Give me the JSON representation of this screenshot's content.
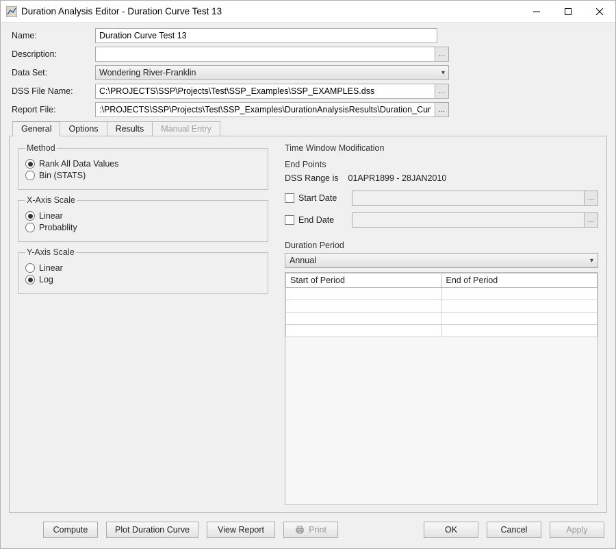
{
  "window": {
    "title": "Duration Analysis Editor - Duration Curve Test 13"
  },
  "fields": {
    "name_label": "Name:",
    "name_value": "Duration Curve Test 13",
    "desc_label": "Description:",
    "desc_value": "",
    "data_set_label": "Data Set:",
    "data_set_value": "Wondering River-Franklin",
    "dss_file_label": "DSS File Name:",
    "dss_file_value": "C:\\PROJECTS\\SSP\\Projects\\Test\\SSP_Examples\\SSP_EXAMPLES.dss",
    "report_file_label": "Report File:",
    "report_file_value": ":\\PROJECTS\\SSP\\Projects\\Test\\SSP_Examples\\DurationAnalysisResults\\Duration_Curve_T..."
  },
  "tabs": {
    "general": "General",
    "options": "Options",
    "results": "Results",
    "manual": "Manual Entry"
  },
  "method": {
    "legend": "Method",
    "rank": "Rank All Data Values",
    "bin": "Bin (STATS)"
  },
  "x_axis": {
    "legend": "X-Axis Scale",
    "linear": "Linear",
    "prob": "Probablity"
  },
  "y_axis": {
    "legend": "Y-Axis Scale",
    "linear": "Linear",
    "log": "Log"
  },
  "time_window": {
    "section": "Time Window Modification",
    "end_points": "End Points",
    "dss_range_label": "DSS Range is",
    "dss_range_value": "01APR1899 - 28JAN2010",
    "start_date": "Start Date",
    "end_date": "End Date"
  },
  "duration_period": {
    "section": "Duration Period",
    "value": "Annual",
    "col_start": "Start of Period",
    "col_end": "End of Period"
  },
  "buttons": {
    "compute": "Compute",
    "plot": "Plot Duration Curve",
    "view_report": "View Report",
    "print": "Print",
    "ok": "OK",
    "cancel": "Cancel",
    "apply": "Apply"
  }
}
